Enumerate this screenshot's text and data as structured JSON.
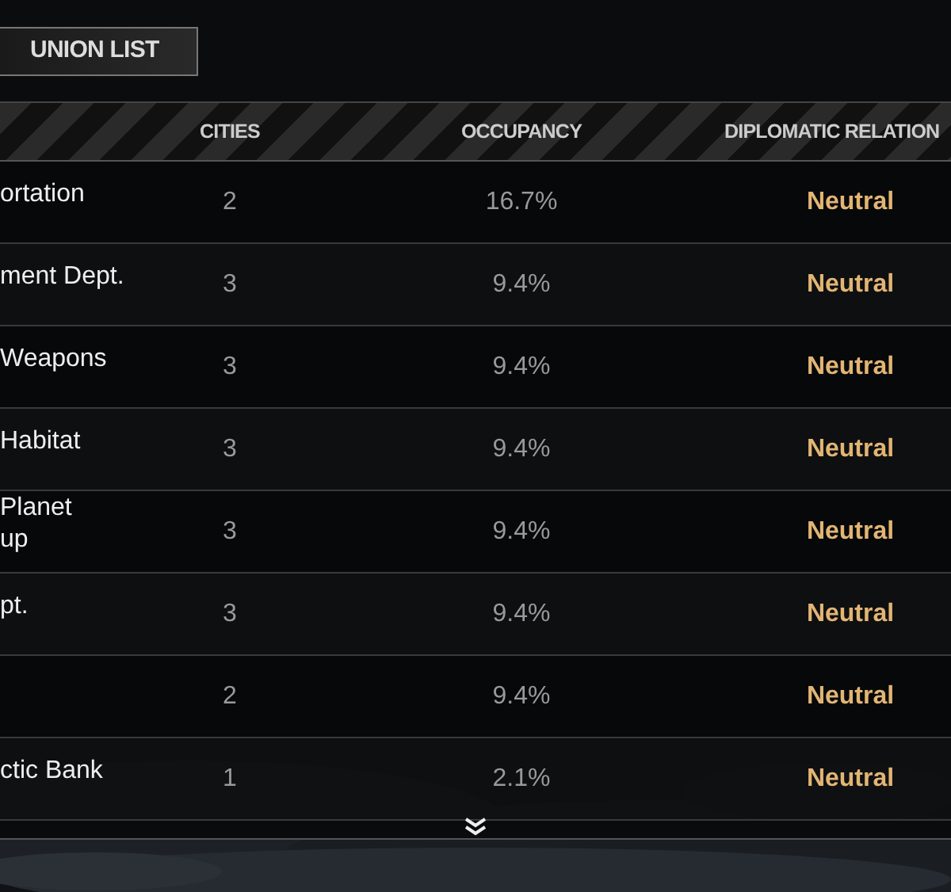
{
  "title_tab": {
    "label": "UNION LIST",
    "selected": true
  },
  "table": {
    "columns": [
      "CITIES",
      "OCCUPANCY",
      "DIPLOMATIC RELATION"
    ],
    "rows": [
      {
        "name_lines": [
          "ortation"
        ],
        "cities": "2",
        "occupancy": "16.7%",
        "relation": "Neutral"
      },
      {
        "name_lines": [
          "ment Dept."
        ],
        "cities": "3",
        "occupancy": "9.4%",
        "relation": "Neutral"
      },
      {
        "name_lines": [
          "Weapons"
        ],
        "cities": "3",
        "occupancy": "9.4%",
        "relation": "Neutral"
      },
      {
        "name_lines": [
          "Habitat"
        ],
        "cities": "3",
        "occupancy": "9.4%",
        "relation": "Neutral"
      },
      {
        "name_lines": [
          "Planet",
          "up"
        ],
        "cities": "3",
        "occupancy": "9.4%",
        "relation": "Neutral"
      },
      {
        "name_lines": [
          "pt."
        ],
        "cities": "3",
        "occupancy": "9.4%",
        "relation": "Neutral"
      },
      {
        "name_lines": [],
        "cities": "2",
        "occupancy": "9.4%",
        "relation": "Neutral"
      },
      {
        "name_lines": [
          "ctic Bank"
        ],
        "cities": "1",
        "occupancy": "2.1%",
        "relation": "Neutral"
      }
    ]
  }
}
